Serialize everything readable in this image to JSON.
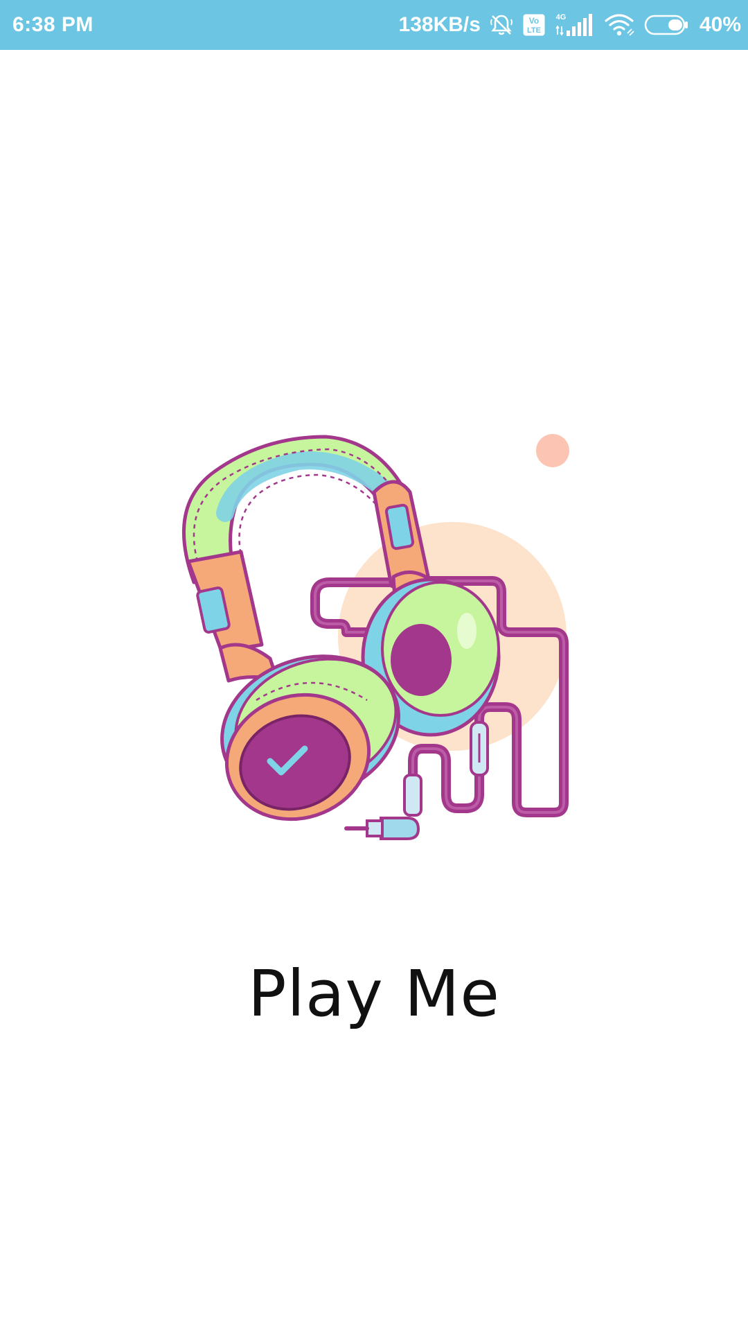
{
  "status_bar": {
    "time": "6:38 PM",
    "network_speed": "138KB/s",
    "volte_label_top": "Vo",
    "volte_label_bottom": "LTE",
    "network_type": "4G",
    "battery_percent": "40%",
    "battery_level": 0.4,
    "icons": [
      "notifications-off-icon",
      "volte-icon",
      "cellular-signal-icon",
      "wifi-icon",
      "battery-icon"
    ],
    "background_color": "#6cc5e2"
  },
  "splash": {
    "illustration": "headphones-illustration",
    "app_name": "Play Me"
  },
  "colors": {
    "cable": "#a3378b",
    "cushion_green": "#c6f59d",
    "cushion_blue": "#7fd3e6",
    "accent_orange": "#f5a878",
    "blob_peach": "#fde2cc",
    "dot_pink": "#fcc5b3"
  }
}
